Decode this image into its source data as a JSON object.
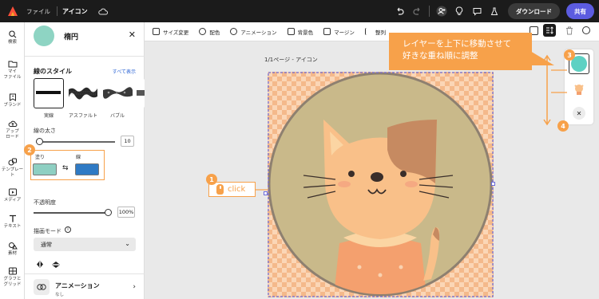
{
  "topbar": {
    "menu_file": "ファイル",
    "doc_title": "アイコン",
    "download": "ダウンロード",
    "share": "共有"
  },
  "rail": {
    "items": [
      "検索",
      "マイ\nファイル",
      "ブランド",
      "アップ\nロード",
      "テンプレート",
      "メディア",
      "テキスト",
      "素材",
      "グラフと\nグリッド"
    ]
  },
  "panel": {
    "title": "楕円",
    "stroke_style_title": "線のスタイル",
    "see_all": "すべて表示",
    "styles": [
      "実線",
      "アスファルト",
      "バブル"
    ],
    "stroke_width_label": "線の太さ",
    "stroke_width_value": "10",
    "stroke_width_level": 0.05,
    "fill_label": "塗り",
    "stroke_label": "線",
    "fill_color": "#8ecfc2",
    "stroke_color": "#2f7ac4",
    "opacity_label": "不透明度",
    "opacity_value": "100%",
    "opacity_level": 1.0,
    "blend_label": "描画モード",
    "blend_value": "通常",
    "animation_title": "アニメーション",
    "animation_sub": "なし"
  },
  "toolbar": {
    "items": [
      "サイズ変更",
      "配色",
      "アニメーション",
      "背景色",
      "マージン",
      "整列",
      "整列"
    ]
  },
  "canvas": {
    "page_label": "1/1ページ - アイコン"
  },
  "annotations": {
    "callout": "レイヤーを上下に移動させて\n好きな重ね順に調整",
    "click": "click",
    "badges": [
      "1",
      "2",
      "3",
      "4"
    ]
  },
  "colors": {
    "accent": "#f7a14a",
    "brand": "#5c5ce0",
    "circle_bg": "#c9b98a",
    "cat": "#f9c089"
  }
}
